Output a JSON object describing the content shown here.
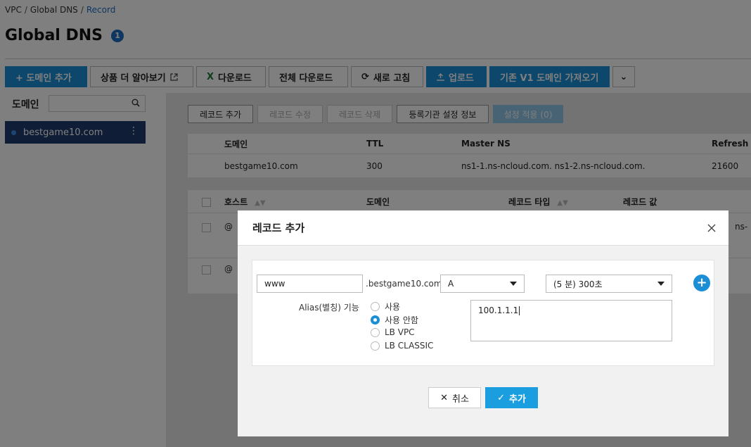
{
  "breadcrumb": {
    "vpc": "VPC",
    "sep": "/",
    "global_dns": "Global DNS",
    "record": "Record"
  },
  "page_title": "Global DNS",
  "title_badge": "1",
  "toolbar": {
    "add_domain": "+ 도메인 추가",
    "learn_more": "상품 더 알아보기",
    "download": "다운로드",
    "download_all": "전체 다운로드",
    "refresh": "새로 고침",
    "upload": "업로드",
    "import_v1": "기존 V1 도메인 가져오기"
  },
  "sidebar": {
    "label": "도메인",
    "search_placeholder": "",
    "items": [
      {
        "label": "bestgame10.com"
      }
    ]
  },
  "record_toolbar": {
    "add": "레코드 추가",
    "edit": "레코드 수정",
    "delete": "레코드 삭제",
    "registrar": "등록기관 설정 정보",
    "apply": "설정 적용 (0)"
  },
  "domain_table": {
    "headers": [
      "도메인",
      "TTL",
      "Master NS",
      "Refresh"
    ],
    "row": [
      "bestgame10.com",
      "300",
      "ns1-1.ns-ncloud.com. ns1-2.ns-ncloud.com.",
      "21600"
    ]
  },
  "record_table": {
    "headers": [
      "호스트",
      "도메인",
      "레코드 타입",
      "레코드 값"
    ],
    "rows": [
      {
        "host": "@",
        "tail": "ns-"
      },
      {
        "host": "@"
      }
    ]
  },
  "modal": {
    "title": "레코드 추가",
    "host_value": "www",
    "domain_suffix": ".bestgame10.com",
    "record_type": "A",
    "ttl": "(5 분) 300초",
    "alias_label": "Alias(별칭) 기능",
    "alias_options": [
      "사용",
      "사용 안함",
      "LB VPC",
      "LB CLASSIC"
    ],
    "alias_selected": "사용 안함",
    "record_value": "100.1.1.1",
    "cancel": "취소",
    "confirm": "추가"
  },
  "colors": {
    "primary": "#1b8ed6",
    "sidebar_active": "#1e3a6e",
    "link": "#1b6ec2"
  }
}
